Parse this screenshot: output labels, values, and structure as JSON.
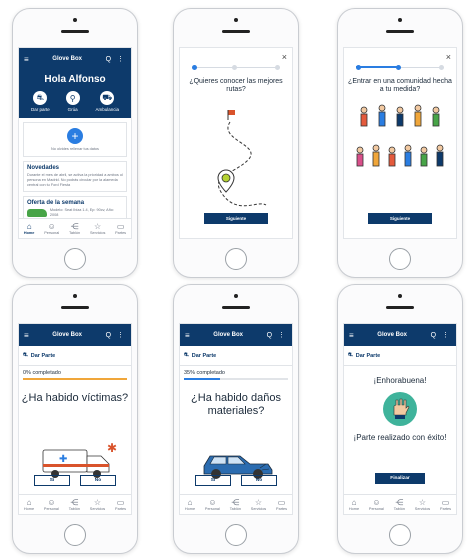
{
  "app": {
    "brand": "Glove Box",
    "menu_glyph": "≡",
    "actions_glyph": "Q ⋮"
  },
  "home": {
    "greeting": "Hola Alfonso",
    "quick_actions": [
      {
        "label": "Dar parte",
        "icon": "document-car-icon",
        "glyph": "⛐"
      },
      {
        "label": "Grúa",
        "icon": "tow-hook-icon",
        "glyph": "⚲"
      },
      {
        "label": "Ambulancia",
        "icon": "ambulance-icon",
        "glyph": "⛟"
      }
    ],
    "add_hint": "No olvides rellenar tus datos",
    "news_title": "Novedades",
    "news_body": "Durante el mes de abril, se activa la prioridad a ambos ol persona en Madrid. No podrás circular por la alameda central con tu Ford Fiesta",
    "offer_title": "Oferta de la semana",
    "offer_body": "Modelo: Seat Ibiza 1.4, Ep: 90cv, Año: 2008"
  },
  "tabs": [
    {
      "label": "Home",
      "icon": "home-icon",
      "glyph": "⌂"
    },
    {
      "label": "Personal",
      "icon": "user-icon",
      "glyph": "☺"
    },
    {
      "label": "Tablón",
      "icon": "share-icon",
      "glyph": "⋲"
    },
    {
      "label": "Servicios",
      "icon": "star-icon",
      "glyph": "☆"
    },
    {
      "label": "Partes",
      "icon": "folder-icon",
      "glyph": "▭"
    }
  ],
  "onboarding1": {
    "title": "¿Quieres conocer las mejores rutas?"
  },
  "onboarding2": {
    "title": "¿Entrar en una comunidad hecha a tu medida?"
  },
  "onboarding_cta": "Siguiente",
  "close_glyph": "×",
  "parte": {
    "header": "Dar Parte",
    "q1": {
      "progress": "0% completado",
      "progress_value": 0,
      "question": "¿Ha habido víctimas?"
    },
    "q2": {
      "progress": "35% completado",
      "progress_value": 35,
      "question": "¿Ha habido daños materiales?"
    },
    "yes": "Sí",
    "no": "No"
  },
  "final": {
    "congrats": "¡Enhorabuena!",
    "done": "¡Parte realizado con éxito!",
    "cta": "Finalizar"
  },
  "colors": {
    "navy": "#0d3a6b",
    "blue": "#2a7de1",
    "orange": "#f0a63a"
  }
}
